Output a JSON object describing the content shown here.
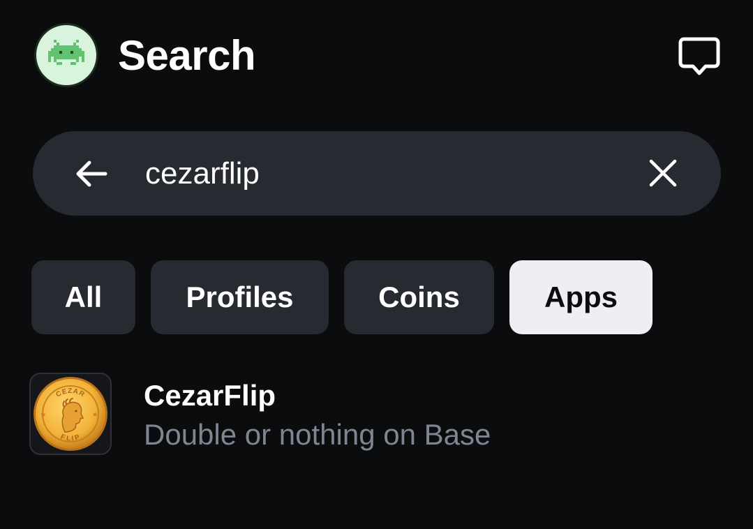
{
  "header": {
    "title": "Search",
    "avatar_icon": "pixel-alien-icon",
    "messages_icon": "chat-bubble-icon"
  },
  "search": {
    "query": "cezarflip",
    "back_icon": "arrow-left-icon",
    "clear_icon": "close-icon"
  },
  "tabs": [
    {
      "label": "All",
      "active": false
    },
    {
      "label": "Profiles",
      "active": false
    },
    {
      "label": "Coins",
      "active": false
    },
    {
      "label": "Apps",
      "active": true
    }
  ],
  "results": [
    {
      "name": "CezarFlip",
      "description": "Double or nothing on Base",
      "icon": "gold-coin-icon",
      "coin_text_top": "CEZAR",
      "coin_text_bottom": "FLIP"
    }
  ],
  "colors": {
    "background": "#0b0c0e",
    "surface": "#272a31",
    "active_tab": "#eeeff3",
    "secondary_text": "#7e8593",
    "avatar_bg": "#d9f4dd",
    "avatar_fg": "#62c26f",
    "coin_gold": "#f2b23a"
  }
}
